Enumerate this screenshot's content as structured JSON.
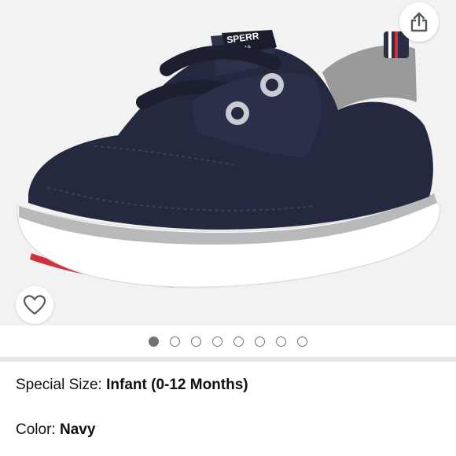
{
  "product": {
    "image_alt": "Navy canvas infant sneaker",
    "brand_text_on_image": "SPERR",
    "brand_subtext_on_image": "Since 19",
    "colors": {
      "canvas": "#25293f",
      "sole": "#ffffff",
      "sole_stripe": "#b7b9bb",
      "heel_tab": "#9a9a9a",
      "outsole_accent": "#d32f3c"
    }
  },
  "icons": {
    "share": "share-icon",
    "favorite": "heart-icon"
  },
  "carousel": {
    "total_dots": 8,
    "active_index": 0
  },
  "variations": {
    "size_label": "Special Size: ",
    "size_value": "Infant (0-12 Months)",
    "color_label": "Color: ",
    "color_value": "Navy"
  }
}
